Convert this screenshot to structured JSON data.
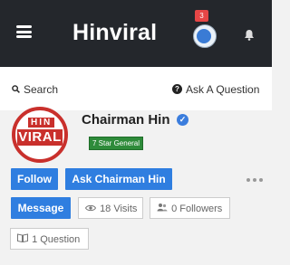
{
  "header": {
    "logo": "Hinviral",
    "notification_count": "3",
    "icons": [
      "menu-icon",
      "user-avatar",
      "bell-icon"
    ]
  },
  "search": {
    "label": "Search",
    "ask_label": "Ask A Question",
    "ask_icon_glyph": "?"
  },
  "profile": {
    "avatar_text_top": "HIN",
    "avatar_text_bottom": "VIRAL",
    "name": "Chairman Hin",
    "verified_glyph": "✓",
    "rank": "7 Star General",
    "buttons": {
      "follow": "Follow",
      "ask": "Ask Chairman Hin",
      "message": "Message"
    },
    "stats": {
      "visits": "18 Visits",
      "followers": "0 Followers",
      "questions": "1 Question"
    }
  },
  "colors": {
    "header_bg": "#24272c",
    "button_blue": "#2f7ee0",
    "rank_green": "#2e8b3a",
    "badge_red": "#e64646",
    "avatar_red": "#c9302c"
  }
}
